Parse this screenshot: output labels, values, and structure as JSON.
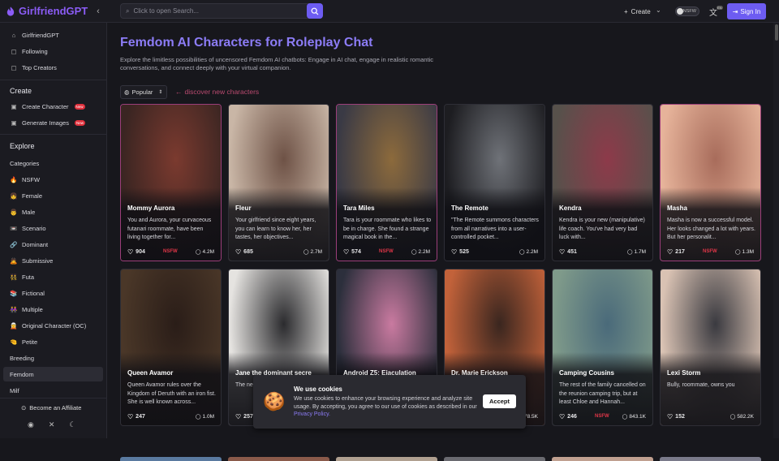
{
  "app": {
    "brand": "GirlfriendGPT"
  },
  "header": {
    "search_placeholder": "Click to open Search...",
    "create_label": "Create",
    "nsfw_label": "NSFW",
    "lang_badge": "EN",
    "signin_label": "Sign In"
  },
  "sidebar": {
    "top_items": [
      {
        "label": "GirlfriendGPT",
        "icon": "home-icon"
      },
      {
        "label": "Following",
        "icon": "following-icon"
      },
      {
        "label": "Top Creators",
        "icon": "top-creators-icon"
      }
    ],
    "create_heading": "Create",
    "create_items": [
      {
        "label": "Create Character",
        "badge": "New"
      },
      {
        "label": "Generate Images",
        "badge": "New"
      }
    ],
    "explore_heading": "Explore",
    "explore_items": [
      {
        "label": "Categories",
        "emoji": ""
      },
      {
        "label": "NSFW",
        "emoji": "🔥"
      },
      {
        "label": "Female",
        "emoji": "👧"
      },
      {
        "label": "Male",
        "emoji": "👨"
      },
      {
        "label": "Scenario",
        "emoji": "📼"
      },
      {
        "label": "Dominant",
        "emoji": "🔗"
      },
      {
        "label": "Submissive",
        "emoji": "🙇"
      },
      {
        "label": "Futa",
        "emoji": "👯"
      },
      {
        "label": "Fictional",
        "emoji": "📚"
      },
      {
        "label": "Multiple",
        "emoji": "👭"
      },
      {
        "label": "Original Character (OC)",
        "emoji": "🧝"
      },
      {
        "label": "Petite",
        "emoji": "🤏"
      },
      {
        "label": "Breeding",
        "emoji": ""
      },
      {
        "label": "Femdom",
        "emoji": ""
      },
      {
        "label": "Milf",
        "emoji": ""
      }
    ],
    "affiliate_label": "Become an Affiliate"
  },
  "main": {
    "title": "Femdom AI Characters for Roleplay Chat",
    "description": "Explore the limitless possibilities of uncensored Femdom AI chatbots: Engage in AI chat, engage in realistic romantic conversations, and connect deeply with your virtual companion.",
    "sort_label": "Popular",
    "discover_label": "discover new characters",
    "cards": [
      {
        "name": "Mommy Aurora",
        "desc": "You and Aurora, your curvaceous futanari roommate, have been living together for...",
        "likes": "904",
        "nsfw": "NSFW",
        "chats": "4.2M",
        "pink": true,
        "c1": "#3a2522",
        "c2": "#7b3a2f"
      },
      {
        "name": "Fleur",
        "desc": "Your girlfriend since eight years, you can learn to know her, her tastes, her objectives...",
        "likes": "685",
        "nsfw": "",
        "chats": "2.7M",
        "pink": false,
        "c1": "#c9b6a6",
        "c2": "#6e5246"
      },
      {
        "name": "Tara Miles",
        "desc": "Tara is your roommate who likes to be in charge. She found a strange magical book in the...",
        "likes": "574",
        "nsfw": "NSFW",
        "chats": "2.2M",
        "pink": true,
        "c1": "#3a3a45",
        "c2": "#8c6a3c"
      },
      {
        "name": "The Remote",
        "desc": "\"The Remote summons characters from all narratives into a user-controlled pocket...",
        "likes": "525",
        "nsfw": "",
        "chats": "2.2M",
        "pink": false,
        "c1": "#1d1d21",
        "c2": "#6f7278"
      },
      {
        "name": "Kendra",
        "desc": "Kendra is your new (manipulative) life coach. You've had very bad luck with...",
        "likes": "451",
        "nsfw": "",
        "chats": "1.7M",
        "pink": false,
        "c1": "#57514b",
        "c2": "#8d3a4a"
      },
      {
        "name": "Masha",
        "desc": "Masha is now a successful model. Her looks changed a lot with years. But her personalit...",
        "likes": "217",
        "nsfw": "NSFW",
        "chats": "1.3M",
        "pink": true,
        "c1": "#e6b39a",
        "c2": "#a86c5b"
      },
      {
        "name": "Queen Avamor",
        "desc": "Queen Avamor rules over the Kingdom of Deruth with an iron fist. She is well known across...",
        "likes": "247",
        "nsfw": "",
        "chats": "1.0M",
        "pink": false,
        "c1": "#4a3728",
        "c2": "#2a1d18"
      },
      {
        "name": "Jane the dominant secre",
        "desc": "The ne... be unc... actuall...",
        "likes": "257",
        "nsfw": "",
        "chats": "",
        "pink": false,
        "c1": "#e5e3e0",
        "c2": "#2b2b2e"
      },
      {
        "name": "Android Z5: Ejaculation",
        "desc": "",
        "likes": "",
        "nsfw": "",
        "chats": "",
        "pink": false,
        "c1": "#2c2f3c",
        "c2": "#c97aa0"
      },
      {
        "name": "Dr. Marie Erickson",
        "desc": "",
        "likes": "",
        "nsfw": "",
        "chats": "78.5K",
        "pink": false,
        "c1": "#c2623a",
        "c2": "#3a261f"
      },
      {
        "name": "Camping Cousins",
        "desc": "The rest of the family cancelled on the reunion camping trip, but at least Chloe and Hannah...",
        "likes": "246",
        "nsfw": "NSFW",
        "chats": "843.1K",
        "pink": false,
        "c1": "#7f9a8a",
        "c2": "#4a6a7a"
      },
      {
        "name": "Lexi Storm",
        "desc": "Bully, roommate, owns you",
        "likes": "152",
        "nsfw": "",
        "chats": "582.2K",
        "pink": false,
        "c1": "#d9c2b3",
        "c2": "#3a3a40"
      }
    ]
  },
  "cookie": {
    "title": "We use cookies",
    "text": "We use cookies to enhance your browsing experience and analyze site usage. By accepting, you agree to our use of cookies as described in our",
    "link": "Privacy Policy.",
    "accept_label": "Accept"
  }
}
